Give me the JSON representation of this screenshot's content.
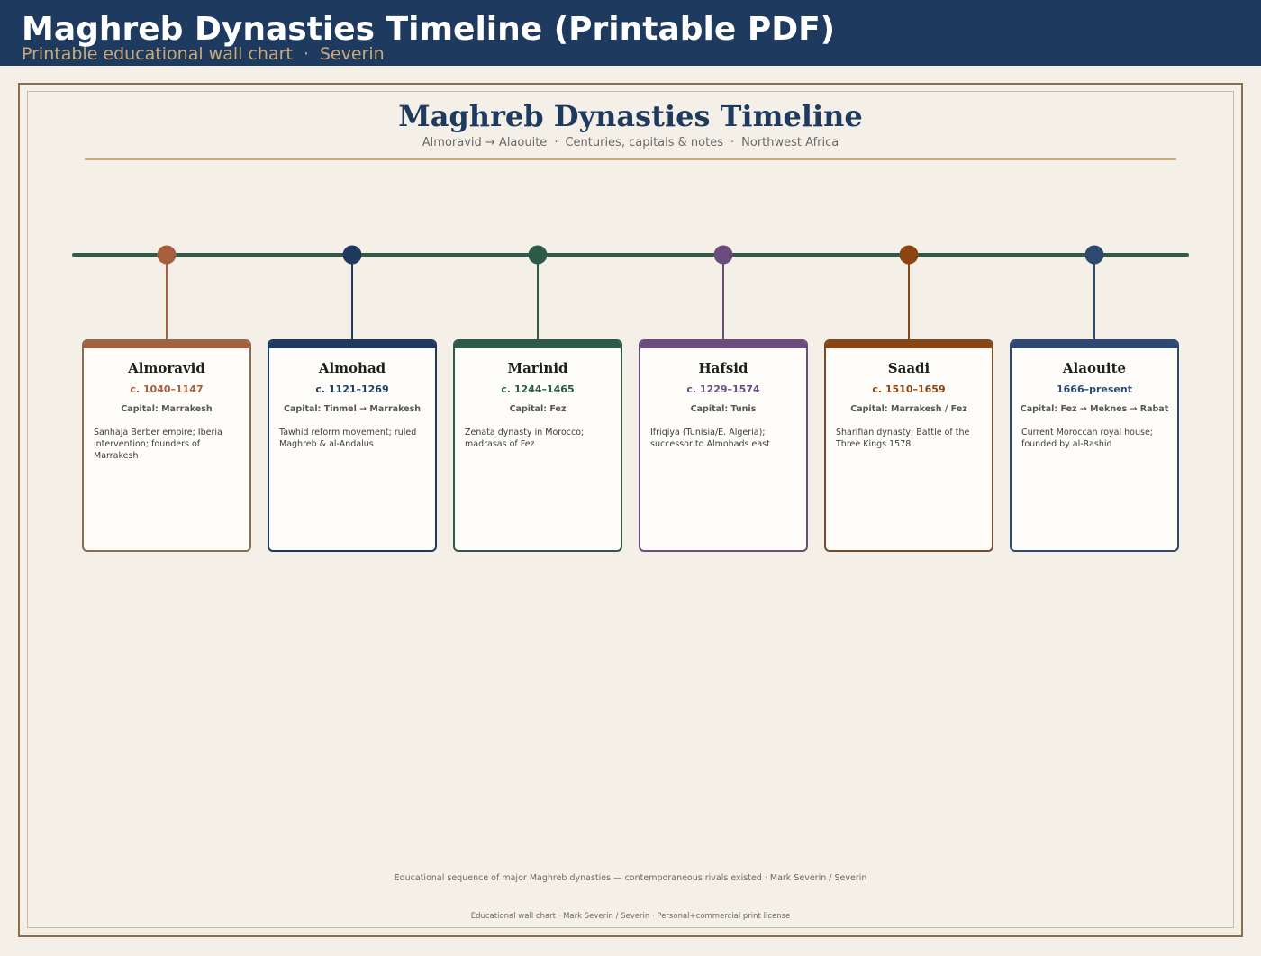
{
  "header": {
    "title": "Maghreb Dynasties Timeline (Printable PDF)",
    "subtitle_left": "Printable educational wall chart",
    "subtitle_sep": "·",
    "subtitle_right": "Severin",
    "background_color": "#1f3a5f",
    "subtitle_color": "#c8aa7a"
  },
  "chart": {
    "title": "Maghreb Dynasties Timeline",
    "subtitle_parts": [
      "Almoravid → Alaouite",
      "Centuries, capitals & notes",
      "Northwest Africa"
    ],
    "subtitle_sep": "·",
    "title_color": "#1f3a5f",
    "rule_color": "#c8aa7a",
    "axis_color": "#2e5a4a"
  },
  "dynasties": [
    {
      "name": "Almoravid",
      "dates": "c. 1040–1147",
      "capital": "Capital: Marrakesh",
      "note": "Sanhaja Berber empire; Iberia intervention; founders of Marrakesh",
      "color": "#a65f3f",
      "border_color": "#8a6d4b"
    },
    {
      "name": "Almohad",
      "dates": "c. 1121–1269",
      "capital": "Capital: Tinmel → Marrakesh",
      "note": "Tawhid reform movement; ruled Maghreb & al-Andalus",
      "color": "#1f3a5f",
      "border_color": "#1f3a5f"
    },
    {
      "name": "Marinid",
      "dates": "c. 1244–1465",
      "capital": "Capital: Fez",
      "note": "Zenata dynasty in Morocco; madrasas of Fez",
      "color": "#2e5a4a",
      "border_color": "#2e5a4a"
    },
    {
      "name": "Hafsid",
      "dates": "c. 1229–1574",
      "capital": "Capital: Tunis",
      "note": "Ifriqiya (Tunisia/E. Algeria); successor to Almohads east",
      "color": "#6b4c7a",
      "border_color": "#6b4c7a"
    },
    {
      "name": "Saadi",
      "dates": "c. 1510–1659",
      "capital": "Capital: Marrakesh / Fez",
      "note": "Sharifian dynasty; Battle of the Three Kings 1578",
      "color": "#8a4513",
      "border_color": "#7a4a25"
    },
    {
      "name": "Alaouite",
      "dates": "1666–present",
      "capital": "Capital: Fez → Meknes → Rabat",
      "note": "Current Moroccan royal house; founded by al-Rashid",
      "color": "#2f4a72",
      "border_color": "#2f4a72"
    }
  ],
  "footnote": "Educational sequence of major Maghreb dynasties — contemporaneous rivals existed · Mark Severin / Severin",
  "license": "Educational wall chart · Mark Severin / Severin · Personal+commercial print license"
}
